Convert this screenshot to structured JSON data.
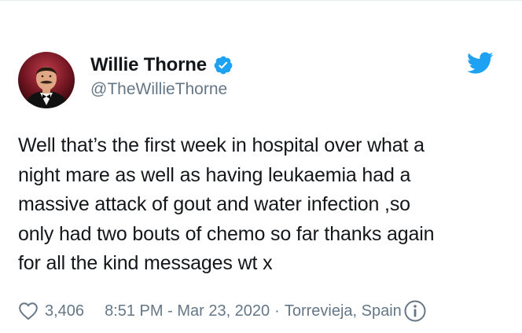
{
  "tweet": {
    "author_name": "Willie Thorne",
    "handle": "@TheWillieThorne",
    "text": "Well that’s the first week in hospital over what a\nnight mare as well as having leukaemia had a\nmassive attack of gout and water infection ,so\nonly had two bouts of chemo so far thanks again\nfor all the kind messages wt x",
    "likes": "3,406",
    "timestamp": "8:51 PM - Mar 23, 2020",
    "separator": "·",
    "location": "Torrevieja, Spain"
  },
  "icons": {
    "verified": "verified-badge-icon",
    "brand": "twitter-bird-icon",
    "like": "heart-icon",
    "info": "info-icon"
  },
  "colors": {
    "brand_blue": "#1da1f2",
    "text_primary": "#14171a",
    "text_secondary": "#657786"
  }
}
